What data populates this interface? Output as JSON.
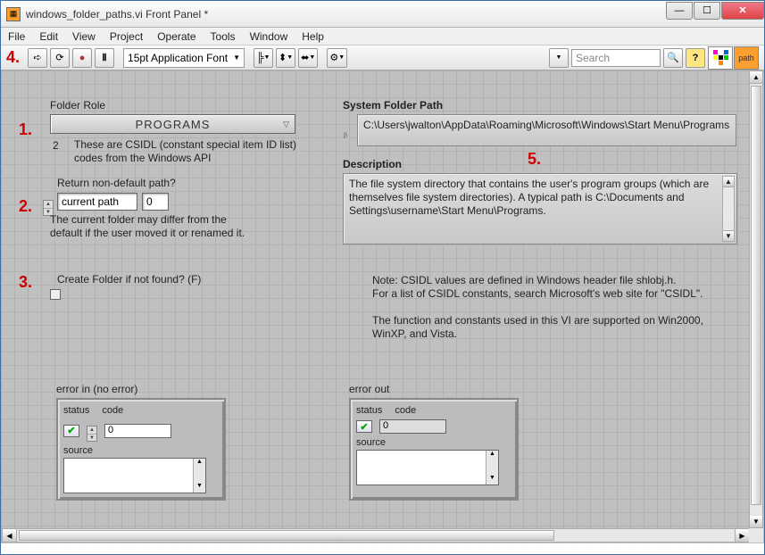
{
  "window": {
    "title": "windows_folder_paths.vi Front Panel *"
  },
  "menu": [
    "File",
    "Edit",
    "View",
    "Project",
    "Operate",
    "Tools",
    "Window",
    "Help"
  ],
  "toolbar": {
    "font": "15pt Application Font",
    "search_placeholder": "Search"
  },
  "annotations": {
    "a1": "1.",
    "a2": "2.",
    "a3": "3.",
    "a4": "4.",
    "a5": "5."
  },
  "folder_role": {
    "label": "Folder Role",
    "value": "PROGRAMS",
    "index": "2",
    "desc": "These are CSIDL (constant special item ID list) codes from the Windows API"
  },
  "return_path": {
    "label": "Return non-default path?",
    "value": "current path",
    "num": "0",
    "desc": "The current folder may differ from the default if the user moved it or renamed it."
  },
  "create_folder": {
    "label": "Create Folder if not found? (F)"
  },
  "sys_path": {
    "label": "System Folder Path",
    "value": "C:\\Users\\jwalton\\AppData\\Roaming\\Microsoft\\Windows\\Start Menu\\Programs"
  },
  "description": {
    "label": "Description",
    "value": "The file system directory that contains the user's program groups (which are themselves file system directories). A typical path is C:\\Documents and Settings\\username\\Start Menu\\Programs."
  },
  "note": "Note:  CSIDL values are defined in Windows header file shlobj.h.\nFor a list of CSIDL constants, search Microsoft's web site for \"CSIDL\".\n\nThe function and constants used in this VI are supported on Win2000, WinXP, and Vista.",
  "err_in": {
    "title": "error in (no error)",
    "status": "status",
    "code_label": "code",
    "code": "0",
    "source": "source"
  },
  "err_out": {
    "title": "error out",
    "status": "status",
    "code_label": "code",
    "code": "0",
    "source": "source"
  }
}
